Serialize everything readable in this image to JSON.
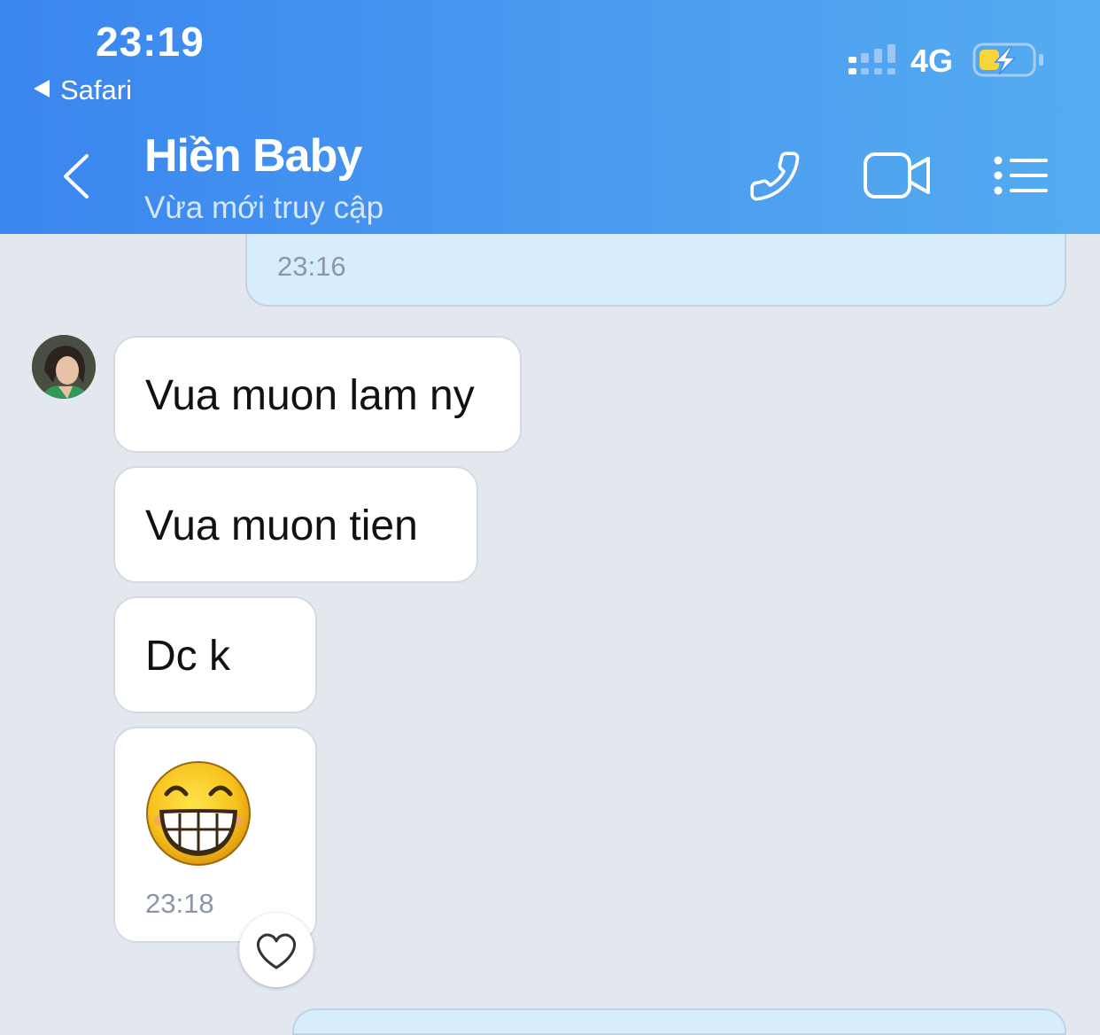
{
  "status_bar": {
    "time": "23:19",
    "back_app": "Safari",
    "network": "4G"
  },
  "header": {
    "contact_name": "Hiền Baby",
    "presence": "Vừa mới truy cập"
  },
  "messages": {
    "sent_time": "23:16",
    "received": [
      {
        "text": "Vua muon lam ny"
      },
      {
        "text": "Vua muon tien"
      },
      {
        "text": "Dc k"
      }
    ],
    "sticker_time": "23:18"
  },
  "colors": {
    "header_start": "#3a86ef",
    "header_end": "#55acf0",
    "chat_background": "#e3e8ef",
    "sent_bubble": "#d7edfc",
    "received_bubble": "#ffffff"
  }
}
